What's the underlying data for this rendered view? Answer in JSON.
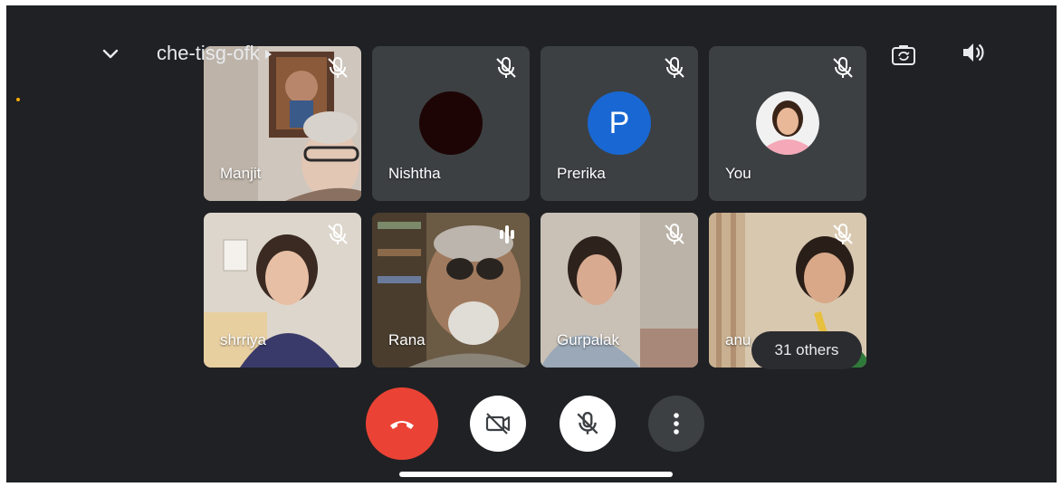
{
  "meeting": {
    "code": "che-tisg-ofk"
  },
  "participants": [
    {
      "name": "Manjit",
      "muted": true,
      "video": "on"
    },
    {
      "name": "Nishtha",
      "muted": true,
      "video": "off"
    },
    {
      "name": "Prerika",
      "muted": true,
      "video": "off",
      "initial": "P"
    },
    {
      "name": "You",
      "muted": true,
      "video": "off"
    },
    {
      "name": "shrriya",
      "muted": true,
      "video": "on"
    },
    {
      "name": "Rana",
      "muted": false,
      "speaking": true,
      "video": "on"
    },
    {
      "name": "Gurpalak",
      "muted": true,
      "video": "on"
    },
    {
      "name": "anu",
      "muted": true,
      "video": "on"
    }
  ],
  "others_label": "31 others",
  "controls": {
    "end_call": "phone-hangup-icon",
    "camera": "camera-off-icon",
    "microphone": "mic-off-icon",
    "more": "more-vert-icon"
  },
  "top_icons": {
    "collapse": "chevron-down-icon",
    "switch_camera": "switch-camera-icon",
    "speaker": "speaker-icon"
  },
  "colors": {
    "background": "#202124",
    "end_call": "#ea4335",
    "avatar_blue": "#1967d2"
  }
}
